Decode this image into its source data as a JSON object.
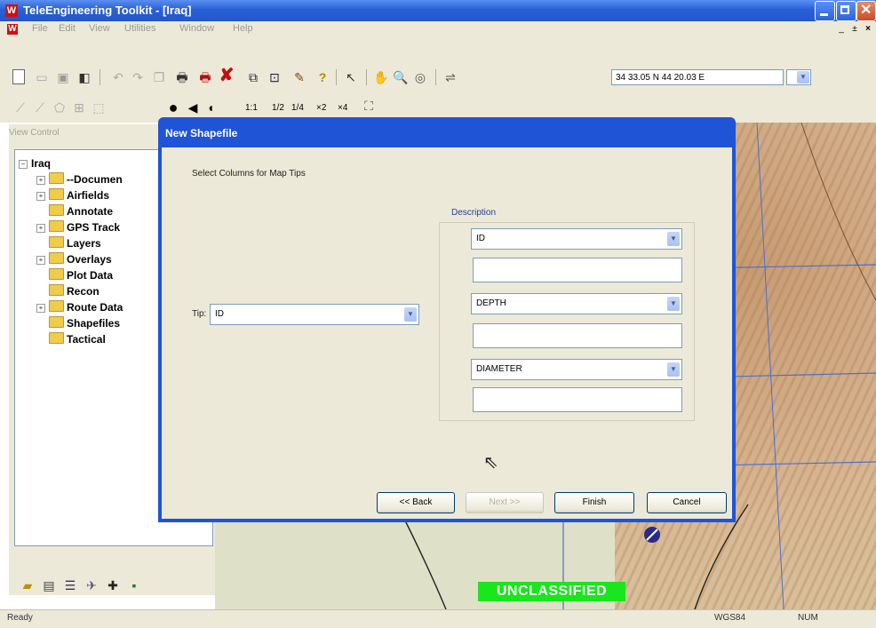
{
  "window": {
    "title": "TeleEngineering Toolkit - [Iraq]",
    "icon": "app-icon",
    "controls": [
      "minimize-icon",
      "maximize-icon",
      "close-icon"
    ]
  },
  "menubar": {
    "items": [
      "File",
      "Edit",
      "View",
      "Utilities",
      "Window",
      "Help"
    ],
    "mdi_controls": [
      "_",
      "±",
      "×"
    ]
  },
  "toolbar": {
    "coordinates": "34 33.05 N  44 20.03 E",
    "zoom_labels": [
      "1:1",
      "1/2",
      "1/4",
      "×2",
      "×4"
    ]
  },
  "left_panel": {
    "view_control_label": "View Control",
    "tree": {
      "root": "Iraq",
      "items": [
        {
          "label": "--Documen",
          "expandable": true
        },
        {
          "label": "Airfields",
          "expandable": true
        },
        {
          "label": "Annotate",
          "expandable": false
        },
        {
          "label": "GPS Track",
          "expandable": true
        },
        {
          "label": "Layers",
          "expandable": false
        },
        {
          "label": "Overlays",
          "expandable": true
        },
        {
          "label": "Plot Data",
          "expandable": false
        },
        {
          "label": "Recon",
          "expandable": false
        },
        {
          "label": "Route Data",
          "expandable": true
        },
        {
          "label": "Shapefiles",
          "expandable": false
        },
        {
          "label": "Tactical",
          "expandable": false
        }
      ]
    }
  },
  "map": {
    "banner": "UNCLASSIFIED",
    "banner_color": "#19e61c"
  },
  "statusbar": {
    "left": "Ready",
    "datum": "WGS84",
    "num": "NUM"
  },
  "dialog": {
    "title": "New Shapefile",
    "instruction": "Select Columns for Map Tips",
    "tip_label": "Tip:",
    "tip_value": "ID",
    "description_label": "Description",
    "description_fields": [
      {
        "value": "ID",
        "text": ""
      },
      {
        "value": "DEPTH",
        "text": ""
      },
      {
        "value": "DIAMETER",
        "text": ""
      }
    ],
    "buttons": {
      "back": "<< Back",
      "next": "Next >>",
      "finish": "Finish",
      "cancel": "Cancel"
    }
  },
  "colors": {
    "title_bar": "#2a5fd8",
    "dialog_frame": "#1f54d6",
    "dialog_body": "#ece9d8"
  }
}
